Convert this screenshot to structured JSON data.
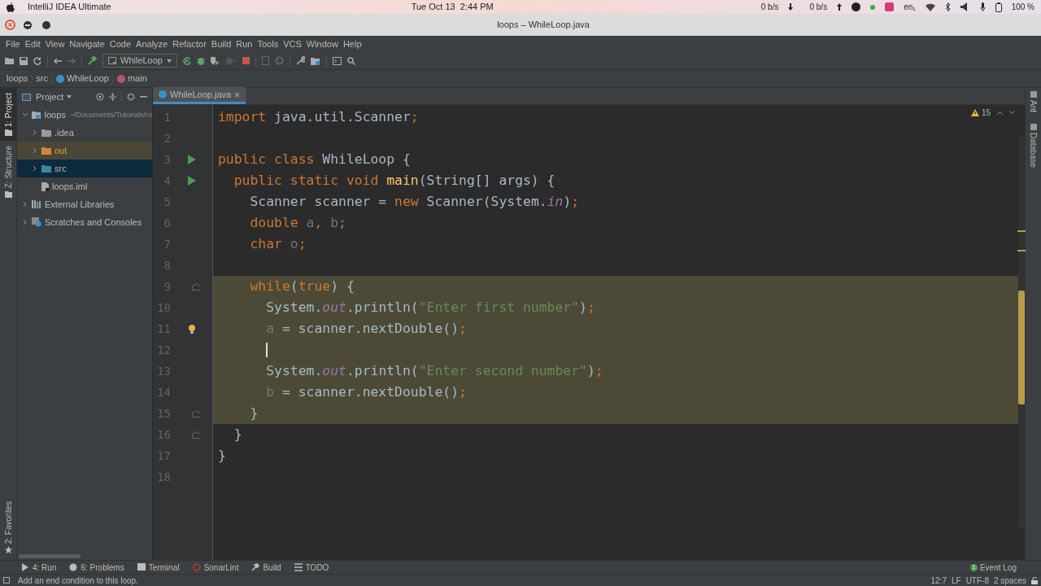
{
  "os_bar": {
    "app": "IntelliJ IDEA Ultimate",
    "clock": "Tue Oct 13  2:44 PM",
    "net_down": "0 b/s",
    "net_up": "0 b/s",
    "lang": "en₁",
    "battery": "100 %"
  },
  "window": {
    "title": "loops – WhileLoop.java"
  },
  "menu": [
    "File",
    "Edit",
    "View",
    "Navigate",
    "Code",
    "Analyze",
    "Refactor",
    "Build",
    "Run",
    "Tools",
    "VCS",
    "Window",
    "Help"
  ],
  "toolbar": {
    "run_config": "WhileLoop"
  },
  "breadcrumbs": [
    {
      "label": "loops",
      "kind": "plain"
    },
    {
      "label": "src",
      "kind": "plain"
    },
    {
      "label": "WhileLoop",
      "kind": "class"
    },
    {
      "label": "main",
      "kind": "method"
    }
  ],
  "left_stripe": [
    {
      "label": "1: Project",
      "selected": true
    },
    {
      "label": "Z: Structure",
      "selected": false
    }
  ],
  "left_stripe_bottom": {
    "label": "2: Favorites"
  },
  "project_panel": {
    "title": "Project",
    "tree": [
      {
        "label": "loops",
        "path": "~/Documents/Tutorials/ro",
        "kind": "module",
        "expanded": true,
        "selected": false,
        "excluded": false,
        "children": [
          {
            "label": ".idea",
            "kind": "folder",
            "expanded": false,
            "selected": false,
            "excluded": false
          },
          {
            "label": "out",
            "kind": "folder",
            "expanded": false,
            "selected": false,
            "excluded": true
          },
          {
            "label": "src",
            "kind": "folder",
            "expanded": false,
            "selected": true,
            "excluded": false
          },
          {
            "label": "loops.iml",
            "kind": "file",
            "selected": false,
            "excluded": false
          }
        ]
      },
      {
        "label": "External Libraries",
        "kind": "libraries",
        "expanded": false,
        "selected": false,
        "excluded": false
      },
      {
        "label": "Scratches and Consoles",
        "kind": "scratches",
        "expanded": false,
        "selected": false,
        "excluded": false
      }
    ]
  },
  "editor": {
    "tab": "WhileLoop.java",
    "warnings": "15",
    "lines": [
      {
        "number": "1",
        "kind": "plain",
        "selected": false,
        "tokens": [
          {
            "text": "import ",
            "kind": "keyword"
          },
          {
            "text": "java.util.Scanner",
            "kind": "plain"
          },
          {
            "text": ";",
            "kind": "keyword"
          }
        ]
      },
      {
        "number": "2",
        "kind": "plain",
        "selected": false
      },
      {
        "number": "3",
        "kind": "run",
        "selected": false,
        "tokens": [
          {
            "text": "public class ",
            "kind": "keyword"
          },
          {
            "text": "WhileLoop {",
            "kind": "plain"
          }
        ]
      },
      {
        "number": "4",
        "kind": "run",
        "selected": false,
        "tokens": [
          {
            "text": "  public static void ",
            "kind": "keyword"
          },
          {
            "text": "main",
            "kind": "method"
          },
          {
            "text": "(String[] args) {",
            "kind": "plain"
          }
        ]
      },
      {
        "number": "5",
        "kind": "plain",
        "selected": false,
        "tokens": [
          {
            "text": "    Scanner scanner = ",
            "kind": "plain"
          },
          {
            "text": "new ",
            "kind": "keyword"
          },
          {
            "text": "Scanner(System.",
            "kind": "plain"
          },
          {
            "text": "in",
            "kind": "field"
          },
          {
            "text": ")",
            "kind": "plain"
          },
          {
            "text": ";",
            "kind": "keyword"
          }
        ]
      },
      {
        "number": "6",
        "kind": "plain",
        "selected": false,
        "tokens": [
          {
            "text": "    double ",
            "kind": "keyword"
          },
          {
            "text": "a",
            "kind": "unused"
          },
          {
            "text": ", ",
            "kind": "keyword"
          },
          {
            "text": "b",
            "kind": "unused"
          },
          {
            "text": ";",
            "kind": "keyword"
          }
        ]
      },
      {
        "number": "7",
        "kind": "plain",
        "selected": false,
        "tokens": [
          {
            "text": "    char ",
            "kind": "keyword"
          },
          {
            "text": "o",
            "kind": "unused"
          },
          {
            "text": ";",
            "kind": "keyword"
          }
        ]
      },
      {
        "number": "8",
        "kind": "plain",
        "selected": false
      },
      {
        "number": "9",
        "kind": "fold",
        "selected": true,
        "tokens": [
          {
            "text": "    while",
            "kind": "keyword"
          },
          {
            "text": "(",
            "kind": "plain"
          },
          {
            "text": "true",
            "kind": "keyword"
          },
          {
            "text": ") {",
            "kind": "plain"
          }
        ]
      },
      {
        "number": "10",
        "kind": "plain",
        "selected": true,
        "tokens": [
          {
            "text": "      System.",
            "kind": "plain"
          },
          {
            "text": "out",
            "kind": "field"
          },
          {
            "text": ".println(",
            "kind": "plain"
          },
          {
            "text": "\"Enter first number\"",
            "kind": "string"
          },
          {
            "text": ")",
            "kind": "plain"
          },
          {
            "text": ";",
            "kind": "keyword"
          }
        ]
      },
      {
        "number": "11",
        "kind": "bulb",
        "selected": true,
        "tokens": [
          {
            "text": "      a",
            "kind": "unused"
          },
          {
            "text": " = scanner.nextDouble()",
            "kind": "plain"
          },
          {
            "text": ";",
            "kind": "keyword"
          }
        ]
      },
      {
        "number": "12",
        "kind": "caret",
        "selected": true
      },
      {
        "number": "13",
        "kind": "plain",
        "selected": true,
        "tokens": [
          {
            "text": "      System.",
            "kind": "plain"
          },
          {
            "text": "out",
            "kind": "field"
          },
          {
            "text": ".println(",
            "kind": "plain"
          },
          {
            "text": "\"Enter second number\"",
            "kind": "string"
          },
          {
            "text": ")",
            "kind": "plain"
          },
          {
            "text": ";",
            "kind": "keyword"
          }
        ]
      },
      {
        "number": "14",
        "kind": "plain",
        "selected": true,
        "tokens": [
          {
            "text": "      b",
            "kind": "unused"
          },
          {
            "text": " = scanner.nextDouble()",
            "kind": "plain"
          },
          {
            "text": ";",
            "kind": "keyword"
          }
        ]
      },
      {
        "number": "15",
        "kind": "fold",
        "selected": true,
        "tokens": [
          {
            "text": "    }",
            "kind": "plain"
          }
        ]
      },
      {
        "number": "16",
        "kind": "fold",
        "selected": false,
        "tokens": [
          {
            "text": "  }",
            "kind": "plain"
          }
        ]
      },
      {
        "number": "17",
        "kind": "plain",
        "selected": false,
        "tokens": [
          {
            "text": "}",
            "kind": "plain"
          }
        ]
      },
      {
        "number": "18",
        "kind": "plain",
        "selected": false
      }
    ]
  },
  "right_stripe": [
    "Ant",
    "Database"
  ],
  "tool_windows": [
    {
      "label": "4: Run",
      "kind": "run"
    },
    {
      "label": "6: Problems",
      "kind": "problems"
    },
    {
      "label": "Terminal",
      "kind": "terminal"
    },
    {
      "label": "SonarLint",
      "kind": "sonar"
    },
    {
      "label": "Build",
      "kind": "build"
    },
    {
      "label": "TODO",
      "kind": "todo"
    }
  ],
  "event_log": {
    "label": "Event Log",
    "count": "1"
  },
  "status_bar": {
    "message": "Add an end condition to this loop.",
    "position": "12:7",
    "line_sep": "LF",
    "encoding": "UTF-8",
    "indent": "2 spaces"
  }
}
